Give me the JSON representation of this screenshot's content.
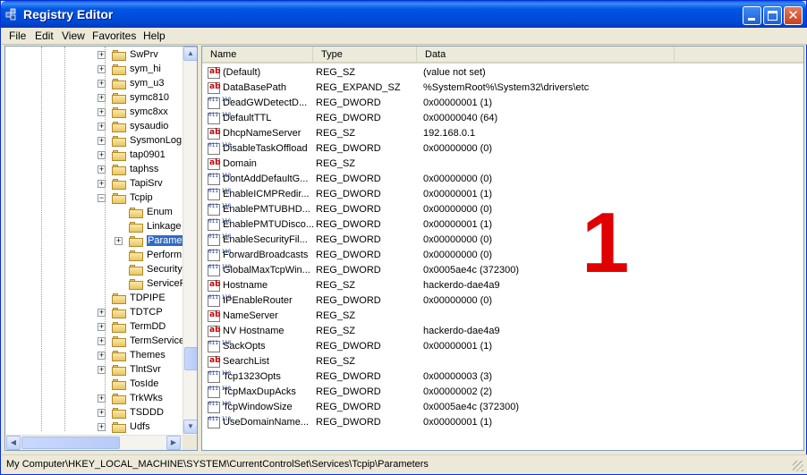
{
  "window": {
    "title": "Registry Editor"
  },
  "menu": [
    "File",
    "Edit",
    "View",
    "Favorites",
    "Help"
  ],
  "tree": {
    "items": [
      {
        "label": "SwPrv",
        "level": 0,
        "expander": "+"
      },
      {
        "label": "sym_hi",
        "level": 0,
        "expander": "+"
      },
      {
        "label": "sym_u3",
        "level": 0,
        "expander": "+"
      },
      {
        "label": "symc810",
        "level": 0,
        "expander": "+"
      },
      {
        "label": "symc8xx",
        "level": 0,
        "expander": "+"
      },
      {
        "label": "sysaudio",
        "level": 0,
        "expander": "+"
      },
      {
        "label": "SysmonLog",
        "level": 0,
        "expander": "+"
      },
      {
        "label": "tap0901",
        "level": 0,
        "expander": "+"
      },
      {
        "label": "taphss",
        "level": 0,
        "expander": "+"
      },
      {
        "label": "TapiSrv",
        "level": 0,
        "expander": "+"
      },
      {
        "label": "Tcpip",
        "level": 0,
        "expander": "-"
      },
      {
        "label": "Enum",
        "level": 1,
        "expander": ""
      },
      {
        "label": "Linkage",
        "level": 1,
        "expander": ""
      },
      {
        "label": "Paramet",
        "level": 1,
        "expander": "+",
        "selected": true
      },
      {
        "label": "Perform",
        "level": 1,
        "expander": ""
      },
      {
        "label": "Security",
        "level": 1,
        "expander": ""
      },
      {
        "label": "ServiceP",
        "level": 1,
        "expander": ""
      },
      {
        "label": "TDPIPE",
        "level": 0,
        "expander": ""
      },
      {
        "label": "TDTCP",
        "level": 0,
        "expander": "+"
      },
      {
        "label": "TermDD",
        "level": 0,
        "expander": "+"
      },
      {
        "label": "TermService",
        "level": 0,
        "expander": "+"
      },
      {
        "label": "Themes",
        "level": 0,
        "expander": "+"
      },
      {
        "label": "TlntSvr",
        "level": 0,
        "expander": "+"
      },
      {
        "label": "TosIde",
        "level": 0,
        "expander": ""
      },
      {
        "label": "TrkWks",
        "level": 0,
        "expander": "+"
      },
      {
        "label": "TSDDD",
        "level": 0,
        "expander": "+"
      },
      {
        "label": "Udfs",
        "level": 0,
        "expander": "+"
      }
    ]
  },
  "list": {
    "columns": [
      "Name",
      "Type",
      "Data"
    ],
    "rows": [
      {
        "icon": "string-value-icon",
        "name": "(Default)",
        "type": "REG_SZ",
        "data": "(value not set)"
      },
      {
        "icon": "string-value-icon",
        "name": "DataBasePath",
        "type": "REG_EXPAND_SZ",
        "data": "%SystemRoot%\\System32\\drivers\\etc"
      },
      {
        "icon": "binary-value-icon",
        "name": "DeadGWDetectD...",
        "type": "REG_DWORD",
        "data": "0x00000001 (1)"
      },
      {
        "icon": "binary-value-icon",
        "name": "DefaultTTL",
        "type": "REG_DWORD",
        "data": "0x00000040 (64)"
      },
      {
        "icon": "string-value-icon",
        "name": "DhcpNameServer",
        "type": "REG_SZ",
        "data": "192.168.0.1"
      },
      {
        "icon": "binary-value-icon",
        "name": "DisableTaskOffload",
        "type": "REG_DWORD",
        "data": "0x00000000 (0)"
      },
      {
        "icon": "string-value-icon",
        "name": "Domain",
        "type": "REG_SZ",
        "data": ""
      },
      {
        "icon": "binary-value-icon",
        "name": "DontAddDefaultG...",
        "type": "REG_DWORD",
        "data": "0x00000000 (0)"
      },
      {
        "icon": "binary-value-icon",
        "name": "EnableICMPRedir...",
        "type": "REG_DWORD",
        "data": "0x00000001 (1)"
      },
      {
        "icon": "binary-value-icon",
        "name": "EnablePMTUBHD...",
        "type": "REG_DWORD",
        "data": "0x00000000 (0)"
      },
      {
        "icon": "binary-value-icon",
        "name": "EnablePMTUDisco...",
        "type": "REG_DWORD",
        "data": "0x00000001 (1)"
      },
      {
        "icon": "binary-value-icon",
        "name": "EnableSecurityFil...",
        "type": "REG_DWORD",
        "data": "0x00000000 (0)"
      },
      {
        "icon": "binary-value-icon",
        "name": "ForwardBroadcasts",
        "type": "REG_DWORD",
        "data": "0x00000000 (0)"
      },
      {
        "icon": "binary-value-icon",
        "name": "GlobalMaxTcpWin...",
        "type": "REG_DWORD",
        "data": "0x0005ae4c (372300)"
      },
      {
        "icon": "string-value-icon",
        "name": "Hostname",
        "type": "REG_SZ",
        "data": "hackerdo-dae4a9"
      },
      {
        "icon": "binary-value-icon",
        "name": "IPEnableRouter",
        "type": "REG_DWORD",
        "data": "0x00000000 (0)"
      },
      {
        "icon": "string-value-icon",
        "name": "NameServer",
        "type": "REG_SZ",
        "data": ""
      },
      {
        "icon": "string-value-icon",
        "name": "NV Hostname",
        "type": "REG_SZ",
        "data": "hackerdo-dae4a9"
      },
      {
        "icon": "binary-value-icon",
        "name": "SackOpts",
        "type": "REG_DWORD",
        "data": "0x00000001 (1)"
      },
      {
        "icon": "string-value-icon",
        "name": "SearchList",
        "type": "REG_SZ",
        "data": ""
      },
      {
        "icon": "binary-value-icon",
        "name": "Tcp1323Opts",
        "type": "REG_DWORD",
        "data": "0x00000003 (3)"
      },
      {
        "icon": "binary-value-icon",
        "name": "TcpMaxDupAcks",
        "type": "REG_DWORD",
        "data": "0x00000002 (2)"
      },
      {
        "icon": "binary-value-icon",
        "name": "TcpWindowSize",
        "type": "REG_DWORD",
        "data": "0x0005ae4c (372300)"
      },
      {
        "icon": "binary-value-icon",
        "name": "UseDomainName...",
        "type": "REG_DWORD",
        "data": "0x00000001 (1)"
      }
    ]
  },
  "annotation": "1",
  "status": "My Computer\\HKEY_LOCAL_MACHINE\\SYSTEM\\CurrentControlSet\\Services\\Tcpip\\Parameters"
}
